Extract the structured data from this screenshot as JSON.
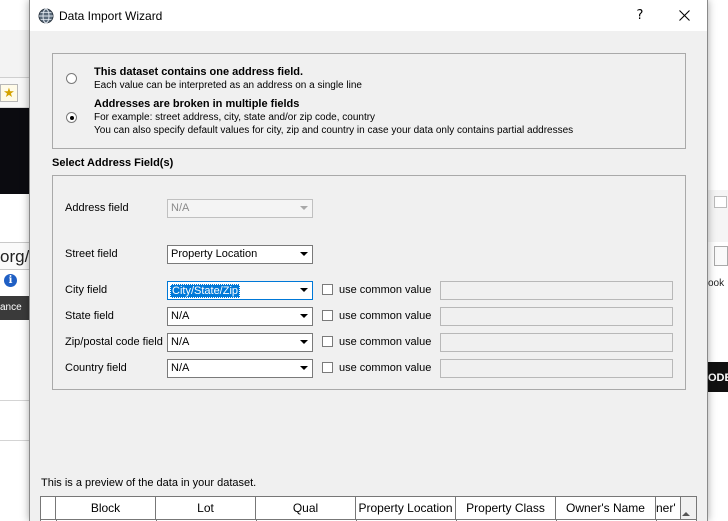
{
  "window": {
    "title": "Data Import Wizard",
    "help_glyph": "?",
    "close_icon": "close-icon"
  },
  "background": {
    "url_fragment": "org/",
    "menu_fragment": "ance",
    "right_fragment_book": "ook",
    "right_fragment_ode": "ODE"
  },
  "address_mode": {
    "selected": "multiple",
    "single": {
      "title": "This dataset contains one address field.",
      "description": "Each value can be interpreted as an address on a single line"
    },
    "multiple": {
      "title": "Addresses are broken in multiple fields",
      "example": "For example: street address, city, state and/or zip code, country",
      "defaults_note": "You can also specify default values for city, zip and country in case your data only contains partial addresses"
    }
  },
  "fields_section": {
    "title": "Select Address Field(s)",
    "address_field": {
      "label": "Address field",
      "value": "N/A",
      "enabled": false
    },
    "street_field": {
      "label": "Street field",
      "value": "Property Location"
    },
    "city_field": {
      "label": "City field",
      "value": "City/State/Zip",
      "common_label": "use common value",
      "common_checked": false,
      "common_value": ""
    },
    "state_field": {
      "label": "State field",
      "value": "N/A",
      "common_label": "use common value",
      "common_checked": false,
      "common_value": ""
    },
    "zip_field": {
      "label": "Zip/postal code field",
      "value": "N/A",
      "common_label": "use common value",
      "common_checked": false,
      "common_value": ""
    },
    "country_field": {
      "label": "Country field",
      "value": "N/A",
      "common_label": "use common value",
      "common_checked": false,
      "common_value": ""
    }
  },
  "preview": {
    "label": "This is a preview of the data in your dataset.",
    "columns": [
      "Block",
      "Lot",
      "Qual",
      "Property Location",
      "Property Class",
      "Owner's Name",
      "ner'"
    ]
  },
  "colors": {
    "selection": "#0078d7",
    "dialog_bg": "#f0f0f0",
    "border": "#a9a9a9"
  }
}
